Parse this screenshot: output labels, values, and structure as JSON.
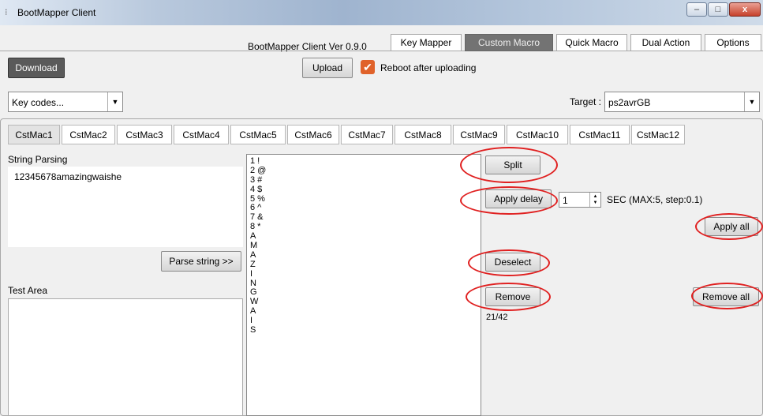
{
  "window": {
    "title": "BootMapper Client",
    "app_icon": "⁝",
    "controls": {
      "minimize": "–",
      "maximize": "□",
      "close": "x"
    }
  },
  "header": {
    "version": "BootMapper Client Ver 0.9.0",
    "tabs": [
      {
        "label": "Key Mapper",
        "active": false
      },
      {
        "label": "Custom Macro",
        "active": true
      },
      {
        "label": "Quick Macro",
        "active": false
      },
      {
        "label": "Dual Action",
        "active": false
      },
      {
        "label": "Options",
        "active": false
      }
    ]
  },
  "toolbar": {
    "download_label": "Download",
    "upload_label": "Upload",
    "reboot_label": "Reboot after uploading",
    "reboot_checked": true,
    "keycodes_value": "Key codes...",
    "target_label": "Target :",
    "target_value": "ps2avrGB"
  },
  "macro_tabs": [
    "CstMac1",
    "CstMac2",
    "CstMac3",
    "CstMac4",
    "CstMac5",
    "CstMac6",
    "CstMac7",
    "CstMac8",
    "CstMac9",
    "CstMac10",
    "CstMac11",
    "CstMac12"
  ],
  "left": {
    "string_label": "String Parsing",
    "string_value": "12345678amazingwaishe",
    "parse_label": "Parse string >>",
    "test_label": "Test Area"
  },
  "list_items": [
    "1 !",
    "2 @",
    "3 #",
    "4 $",
    "5 %",
    "6 ^",
    "7 &",
    "8 *",
    "A",
    "M",
    "A",
    "Z",
    "I",
    "N",
    "G",
    "W",
    "A",
    "I",
    "S"
  ],
  "right": {
    "split_label": "Split",
    "apply_delay_label": "Apply delay",
    "delay_value": "1",
    "sec_label": "SEC (MAX:5, step:0.1)",
    "apply_all_label": "Apply all",
    "deselect_label": "Deselect",
    "remove_label": "Remove",
    "remove_all_label": "Remove all",
    "count": "21/42"
  },
  "colors": {
    "annotation": "#e02020",
    "active_tab": "#737373",
    "checkbox": "#e0622a"
  }
}
